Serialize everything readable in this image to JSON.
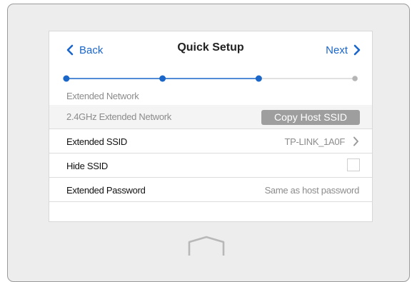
{
  "header": {
    "back_label": "Back",
    "title": "Quick Setup",
    "next_label": "Next"
  },
  "progress": {
    "total_steps": 4,
    "current_step": 3
  },
  "step_label": "Extended Network",
  "section": {
    "label": "2.4GHz Extended Network",
    "copy_button_label": "Copy Host SSID"
  },
  "rows": {
    "extended_ssid": {
      "label": "Extended SSID",
      "value": "TP-LINK_1A0F"
    },
    "hide_ssid": {
      "label": "Hide SSID",
      "checked": false
    },
    "extended_password": {
      "label": "Extended Password",
      "value": "Same as host password"
    }
  },
  "colors": {
    "accent": "#1a66c9",
    "muted_text": "#8c8c8c",
    "button_gray": "#9e9e9e",
    "inactive_step": "#b5b5b5"
  },
  "icons": {
    "back": "chevron-left-icon",
    "next": "chevron-right-icon",
    "ssid_arrow": "chevron-right-icon",
    "home": "home-icon"
  }
}
